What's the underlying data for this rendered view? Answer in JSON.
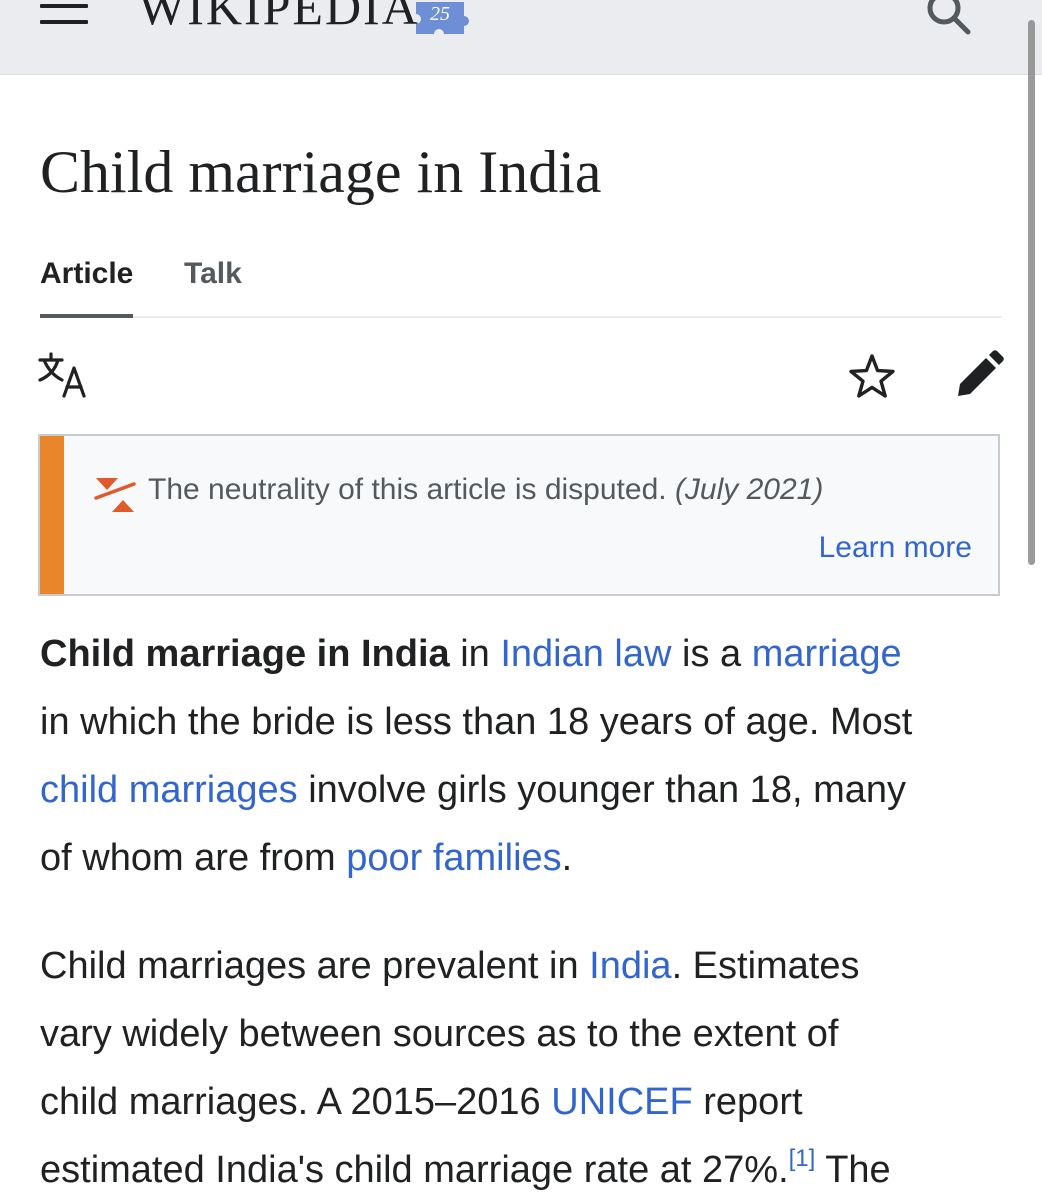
{
  "header": {
    "wordmark": "WIKIPEDIA",
    "badge_text": "25",
    "icons": [
      "menu-icon",
      "search-icon"
    ]
  },
  "article": {
    "title": "Child marriage in India",
    "tabs": [
      {
        "label": "Article",
        "active": true
      },
      {
        "label": "Talk",
        "active": false
      }
    ],
    "actions": [
      "translate-icon",
      "star-icon",
      "edit-icon"
    ]
  },
  "notice": {
    "text": "The neutrality of this article is disputed.",
    "date": "(July 2021)",
    "learn_more": "Learn more",
    "accent_color": "#e9862c"
  },
  "paragraphs": {
    "p1": {
      "line1_bold": "Child marriage in India",
      "line1_in": " in ",
      "link_indian_law": "Indian law",
      "line1_is_a": " is a ",
      "link_marriage": "marriage",
      "line2": "in which the bride is less than 18 years of age. Most",
      "link_child_marriages": "child marriages",
      "line3_rest": " involve girls younger than 18, many",
      "line4_start": "of whom are from ",
      "link_poor_families": "poor families",
      "line4_end": "."
    },
    "p2": {
      "line1_start": "Child marriages are prevalent in ",
      "link_india": "India",
      "line1_end": ". Estimates",
      "line2": "vary widely between sources as to the extent of",
      "line3_start": "child marriages. A 2015–2016 ",
      "link_unicef": "UNICEF",
      "line3_end": " report",
      "line4_start": "estimated India's child marriage rate at 27%.",
      "ref_1": "[1]",
      "line4_end": " The"
    }
  },
  "colors": {
    "link": "#3366cc",
    "text": "#202122",
    "header_bg": "#eaecf0"
  }
}
